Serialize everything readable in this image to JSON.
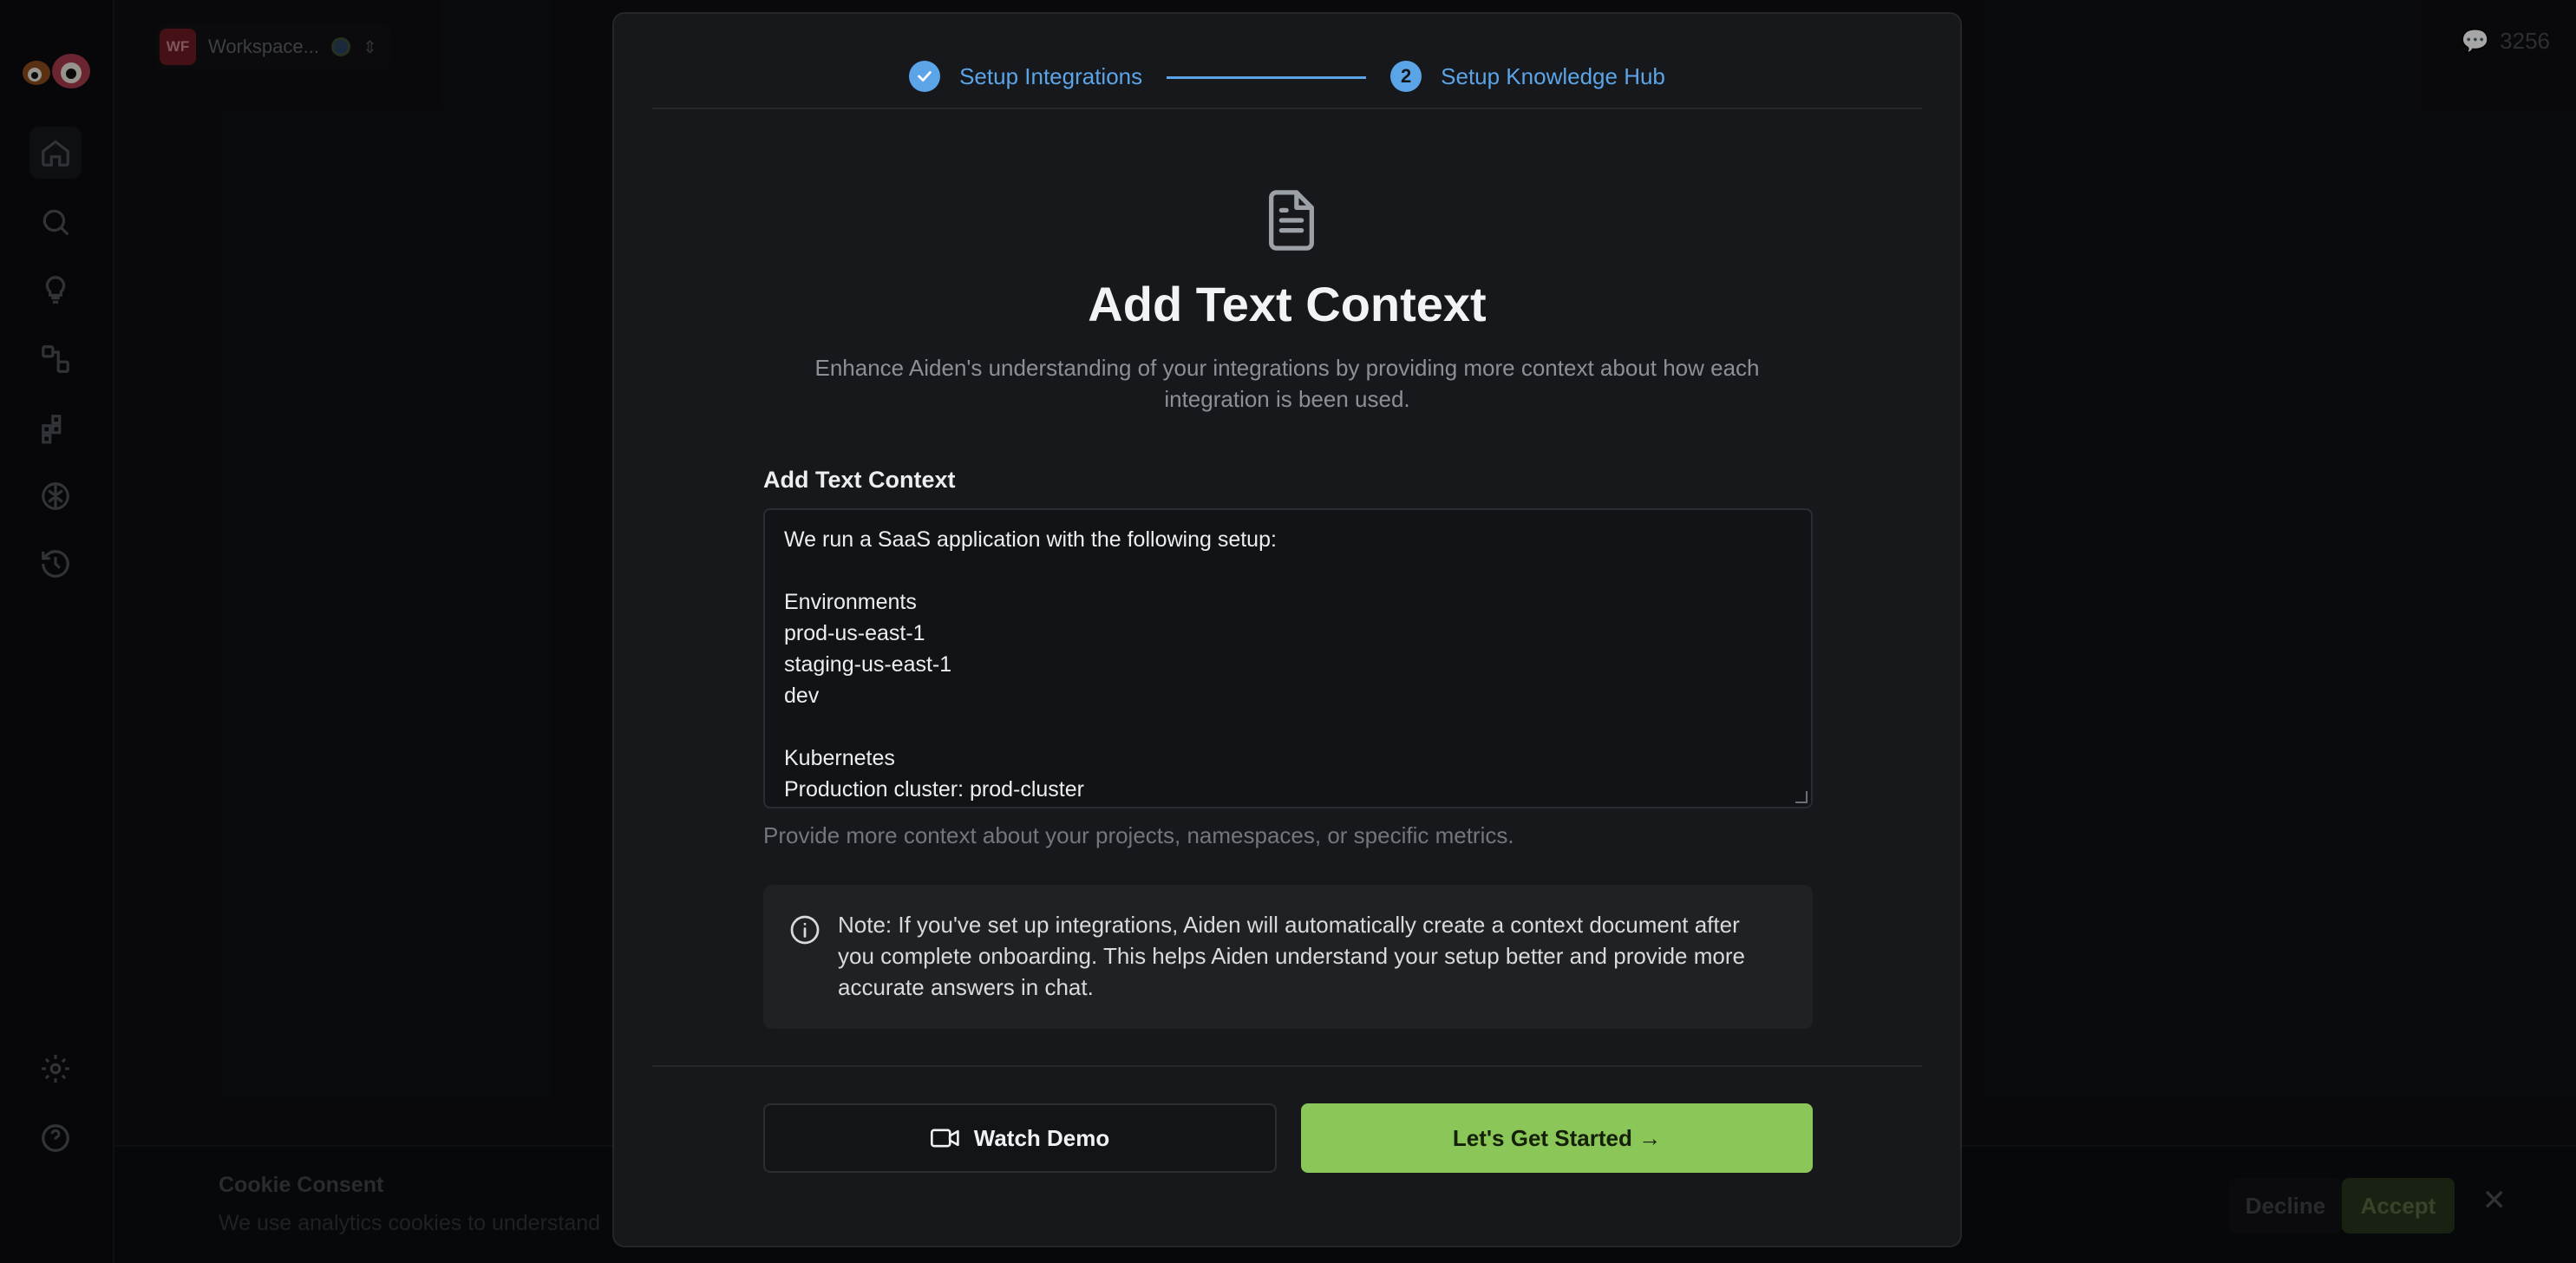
{
  "app": {
    "workspace": {
      "badge": "WF",
      "name": "Workspace..."
    },
    "credits": "3256",
    "nav_icons": [
      "home-icon",
      "search-icon",
      "lightbulb-icon",
      "workflow-icon",
      "integrations-icon",
      "brain-icon",
      "history-icon",
      "gear-icon",
      "help-icon"
    ]
  },
  "cookie": {
    "title": "Cookie Consent",
    "text": "We use analytics cookies to understand",
    "decline": "Decline",
    "accept": "Accept"
  },
  "modal": {
    "steps": [
      {
        "label": "Setup Integrations",
        "state": "done"
      },
      {
        "number": "2",
        "label": "Setup Knowledge Hub",
        "state": "active"
      }
    ],
    "title": "Add Text Context",
    "subtitle": "Enhance Aiden's understanding of your integrations by providing more context about how each integration is been used.",
    "field_label": "Add Text Context",
    "textarea_value": "We run a SaaS application with the following setup:\n\nEnvironments\nprod-us-east-1\nstaging-us-east-1\ndev\n\nKubernetes\nProduction cluster: prod-cluster",
    "helper": "Provide more context about your projects, namespaces, or specific metrics.",
    "note": "Note: If you've set up integrations, Aiden will automatically create a context document after you complete onboarding. This helps Aiden understand your setup better and provide more accurate answers in chat.",
    "watch_demo": "Watch Demo",
    "get_started": "Let's Get Started →"
  },
  "colors": {
    "accent": "#5ba4e8",
    "primary_button": "#8bc659",
    "modal_bg": "#17181b"
  }
}
